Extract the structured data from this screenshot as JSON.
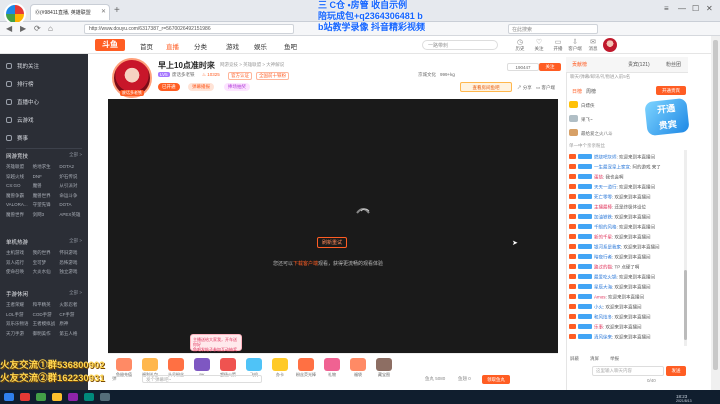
{
  "browser": {
    "tab_title": "Ⓞ(#98411直播, 英雄联盟",
    "address": "http://www.douyu.com/6317387_r=5670026492151986",
    "search_placeholder": "在此搜索",
    "icons": [
      "back-arrow",
      "forward-arrow",
      "refresh",
      "home"
    ]
  },
  "overlay": {
    "line1": "三 C仓 •房管  收自示例",
    "line2": "陪玩成包+q2364306481 b",
    "line3": "b站教学录像 抖音精彩视频"
  },
  "site": {
    "logo": "斗鱼",
    "nav": [
      "首页",
      "直播",
      "分类",
      "游戏",
      "娱乐",
      "游戏",
      "鱼吧"
    ],
    "nav_active": "直播",
    "search_placeholder": "一路带刺",
    "header_icons": [
      {
        "glyph": "◷",
        "label": "历史"
      },
      {
        "glyph": "♡",
        "label": "关注"
      },
      {
        "glyph": "▭",
        "label": "开播"
      },
      {
        "glyph": "⇩",
        "label": "客户端"
      },
      {
        "glyph": "✉",
        "label": "消息"
      }
    ]
  },
  "sidebar": {
    "items": [
      "我的关注",
      "排行榜",
      "直播中心",
      "云游戏",
      "赛事"
    ],
    "sections": [
      {
        "title": "网游竞技",
        "more": "全部 >",
        "games": [
          "英雄联盟",
          "绝地求生",
          "DOTA2",
          "穿越火线",
          "DNF",
          "炉石传说",
          "CS:GO",
          "魔兽",
          "从引派对",
          "魔兽争霸",
          "魔兽世界",
          "命运斗争",
          "VALORA...",
          "守望先锋",
          "DOTA",
          "魔兽世界",
          "剑网3",
          "APEX英雄"
        ]
      },
      {
        "title": "单机热游",
        "more": "全部 >",
        "games": [
          "主机游戏",
          "我的世界",
          "怀旧游戏",
          "双人成行",
          "宝可梦",
          "恐怖游戏",
          "使命召唤",
          "大炎水仙",
          "独立游戏"
        ]
      },
      {
        "title": "手游休闲",
        "more": "全部 >",
        "games": [
          "王者荣耀",
          "和平精英",
          "火影忍者",
          "LOL手游",
          "COD手游",
          "CF手游",
          "双乐乐物语",
          "王者模拟战",
          "原神",
          "天刀手游",
          "御明美作",
          "第五人格"
        ]
      }
    ]
  },
  "room": {
    "title": "早上10点准时来",
    "report": "举报",
    "category": "网游竞技 > 英雄联盟 > 大神解说",
    "level": "LV5",
    "anchor": "废话多老铁",
    "hot": "10325",
    "tag1": "官方认证",
    "tag2": "全国前十铁粉",
    "culture": "京城文化",
    "weight": "999+kg",
    "buttons": [
      "已开通",
      "弹幕播报",
      "捧场抽奖"
    ],
    "fans": "190447",
    "follow": "关注",
    "yuba": "查看房间鱼吧",
    "share": "分享",
    "client": "客户端"
  },
  "player": {
    "refresh": "刷新重试",
    "notice_pre": "您还可以",
    "notice_link": "下载客户端",
    "notice_post": "观看，获得更流畅的观看体验"
  },
  "gifts": [
    {
      "label": "鱼翅充值",
      "color": "#ff8a65"
    },
    {
      "label": "福利礼包",
      "color": "#ffb74d"
    },
    {
      "label": "头号粉丝",
      "color": "#ff7043"
    },
    {
      "label": "BK",
      "color": "#7e57c2"
    },
    {
      "label": "超级火箭",
      "color": "#ef5350"
    },
    {
      "label": "飞机",
      "color": "#4fc3f7"
    },
    {
      "label": "办卡",
      "color": "#ffca28"
    },
    {
      "label": "粉丝荧光棒",
      "color": "#ff7043"
    },
    {
      "label": "礼物",
      "color": "#f06292"
    },
    {
      "label": "福袋",
      "color": "#ff8a65"
    },
    {
      "label": "藏宝图",
      "color": "#8d6e63"
    }
  ],
  "promo": {
    "line1": "主播送给大家我，开车送你好",
    "line2": "鱼吧发帖子参加互动抽奖"
  },
  "bottom": {
    "input_hint": "发个弹幕吧~",
    "balance_label": "鱼丸",
    "balance": "5080",
    "fishball_label": "鱼翅",
    "fishball": "0",
    "get_btn": "领取鱼丸"
  },
  "right": {
    "tabs": [
      "贡献榜",
      "贵宾(121)",
      "粉丝团"
    ],
    "tab_active": "贡献榜",
    "subtabs": [
      "日榜",
      "周榜"
    ],
    "rank_hint": "聊天/弹幕/邮讯/礼物进入前5名",
    "open_guard": "开通贵宾",
    "ranks": [
      "白嫖侠",
      "果飞~",
      "最给爱之火八斗"
    ],
    "guard_text": "开通",
    "guard_sub": "贵宾",
    "chat_header": "单一中个亲亲粉丝",
    "chat": [
      {
        "name": "燃烧吧灰烬",
        "text": "欢迎来到本直播间"
      },
      {
        "name": "一生最宠皇上家宣",
        "text": "阿的游戏 来了"
      },
      {
        "name": "蛋挞",
        "text": "我也会啊"
      },
      {
        "name": "天天一道行",
        "text": "欢迎来到本直播间"
      },
      {
        "name": "死亡零零",
        "text": "欢迎来到本直播间"
      },
      {
        "name": "主播最棒",
        "text": "还是终极体设位"
      },
      {
        "name": "加油铁铁",
        "text": "欢迎来到本直播间"
      },
      {
        "name": "千眼的风格",
        "text": "欢迎来到本直播间"
      },
      {
        "name": "新的千星",
        "text": "欢迎来到本直播间"
      },
      {
        "name": "银河系是我家",
        "text": "欢迎来到本直播间"
      },
      {
        "name": "暗夜行者",
        "text": "欢迎来到本直播间"
      },
      {
        "name": "路过的猫",
        "text": "TP 点硬了啊"
      },
      {
        "name": "最爱吃火锅",
        "text": "欢迎来到本直播间"
      },
      {
        "name": "星辰大海",
        "text": "欢迎来到本直播间"
      },
      {
        "name": "Amos",
        "text": "欢迎来到本直播间"
      },
      {
        "name": "小火",
        "text": "欢迎来到本直播间"
      },
      {
        "name": "和风炫冬",
        "text": "欢迎来到本直播间"
      },
      {
        "name": "乐事",
        "text": "欢迎来到本直播间"
      },
      {
        "name": "清风徐来",
        "text": "欢迎来到本直播间"
      }
    ],
    "opts": [
      "屏蔽",
      "清屏",
      "举报"
    ],
    "input_placeholder": "这里输入聊天内容",
    "send": "发送",
    "count": "0/40"
  },
  "qq": {
    "line1": "火友交流①群536800902",
    "line2": "火友交流②群162230931"
  },
  "taskbar": {
    "time": "18:23",
    "date": "2021/8/13"
  },
  "colors": {
    "accent": "#ff5d23",
    "sidebar": "#2b2e36",
    "player": "#1a1a1a"
  }
}
